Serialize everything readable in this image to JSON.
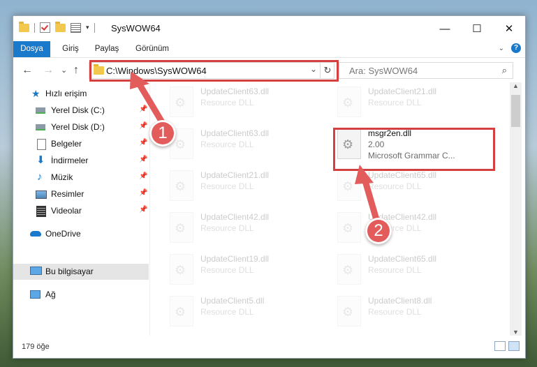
{
  "window": {
    "title": "SysWOW64"
  },
  "title_controls": {
    "minimize": "—",
    "maximize": "☐",
    "close": "✕"
  },
  "ribbon": {
    "tabs": [
      "Dosya",
      "Giriş",
      "Paylaş",
      "Görünüm"
    ],
    "collapse": "⌄",
    "help": "?"
  },
  "nav": {
    "back": "←",
    "forward": "→",
    "recent": "⌄",
    "up": "↑"
  },
  "address": {
    "path": "C:\\Windows\\SysWOW64",
    "dropdown": "⌄",
    "refresh": "↻"
  },
  "search": {
    "placeholder": "Ara: SysWOW64",
    "icon": "⌕"
  },
  "sidebar": {
    "items": [
      {
        "label": "Hızlı erişim",
        "icon": "star-icon",
        "pinned": false
      },
      {
        "label": "Yerel Disk (C:)",
        "icon": "drive-icon",
        "pinned": true
      },
      {
        "label": "Yerel Disk (D:)",
        "icon": "drive-icon",
        "pinned": true
      },
      {
        "label": "Belgeler",
        "icon": "documents-icon",
        "pinned": true
      },
      {
        "label": "İndirmeler",
        "icon": "downloads-icon",
        "pinned": true
      },
      {
        "label": "Müzik",
        "icon": "music-icon",
        "pinned": true
      },
      {
        "label": "Resimler",
        "icon": "pictures-icon",
        "pinned": true
      },
      {
        "label": "Videolar",
        "icon": "videos-icon",
        "pinned": true
      },
      {
        "label": "OneDrive",
        "icon": "cloud-icon",
        "pinned": false
      },
      {
        "label": "Bu bilgisayar",
        "icon": "computer-icon",
        "pinned": false,
        "selected": true
      },
      {
        "label": "Ağ",
        "icon": "network-icon",
        "pinned": false
      }
    ],
    "pin_glyph": "📌"
  },
  "files": {
    "left_column": [
      {
        "name": "UpdateClient63.dll",
        "type": "Resource DLL"
      },
      {
        "name": "UpdateClient63.dll",
        "type": "Resource DLL"
      },
      {
        "name": "UpdateClient21.dll",
        "type": "Resource DLL"
      },
      {
        "name": "UpdateClient42.dll",
        "type": "Resource DLL"
      },
      {
        "name": "UpdateClient19.dll",
        "type": "Resource DLL"
      },
      {
        "name": "UpdateClient5.dll",
        "type": "Resource DLL"
      }
    ],
    "right_column": [
      {
        "name": "UpdateClient21.dll",
        "type": "Resource DLL"
      },
      {
        "name": "msgr2en.dll",
        "version": "2.00",
        "type": "Microsoft Grammar C...",
        "highlighted": true
      },
      {
        "name": "UpdateClient65.dll",
        "type": "Resource DLL"
      },
      {
        "name": "UpdateClient42.dll",
        "type": "Resource DLL"
      },
      {
        "name": "UpdateClient65.dll",
        "type": "Resource DLL"
      },
      {
        "name": "UpdateClient8.dll",
        "type": "Resource DLL"
      }
    ]
  },
  "annotations": {
    "step1": "1",
    "step2": "2",
    "color": "#e35c5c"
  },
  "status": {
    "count": "179 öğe"
  },
  "scroll": {
    "up": "▲",
    "down": "▼"
  }
}
